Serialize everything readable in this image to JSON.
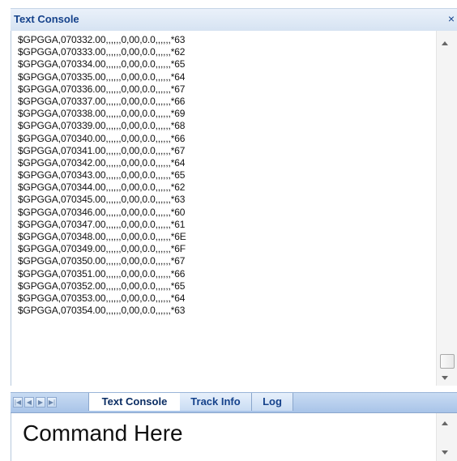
{
  "panel": {
    "title": "Text Console",
    "close_glyph": "×"
  },
  "console": {
    "lines": [
      "$GPGGA,070332.00,,,,,,0,00,0.0,,,,,,*63",
      "$GPGGA,070333.00,,,,,,0,00,0.0,,,,,,*62",
      "$GPGGA,070334.00,,,,,,0,00,0.0,,,,,,*65",
      "$GPGGA,070335.00,,,,,,0,00,0.0,,,,,,*64",
      "$GPGGA,070336.00,,,,,,0,00,0.0,,,,,,*67",
      "$GPGGA,070337.00,,,,,,0,00,0.0,,,,,,*66",
      "$GPGGA,070338.00,,,,,,0,00,0.0,,,,,,*69",
      "$GPGGA,070339.00,,,,,,0,00,0.0,,,,,,*68",
      "$GPGGA,070340.00,,,,,,0,00,0.0,,,,,,*66",
      "$GPGGA,070341.00,,,,,,0,00,0.0,,,,,,*67",
      "$GPGGA,070342.00,,,,,,0,00,0.0,,,,,,*64",
      "$GPGGA,070343.00,,,,,,0,00,0.0,,,,,,*65",
      "$GPGGA,070344.00,,,,,,0,00,0.0,,,,,,*62",
      "$GPGGA,070345.00,,,,,,0,00,0.0,,,,,,*63",
      "$GPGGA,070346.00,,,,,,0,00,0.0,,,,,,*60",
      "$GPGGA,070347.00,,,,,,0,00,0.0,,,,,,*61",
      "$GPGGA,070348.00,,,,,,0,00,0.0,,,,,,*6E",
      "$GPGGA,070349.00,,,,,,0,00,0.0,,,,,,*6F",
      "$GPGGA,070350.00,,,,,,0,00,0.0,,,,,,*67",
      "$GPGGA,070351.00,,,,,,0,00,0.0,,,,,,*66",
      "$GPGGA,070352.00,,,,,,0,00,0.0,,,,,,*65",
      "$GPGGA,070353.00,,,,,,0,00,0.0,,,,,,*64",
      "$GPGGA,070354.00,,,,,,0,00,0.0,,,,,,*63"
    ]
  },
  "tabs": [
    {
      "label": "Text Console",
      "active": true
    },
    {
      "label": "Track Info",
      "active": false
    },
    {
      "label": "Log",
      "active": false
    }
  ],
  "tab_nav": {
    "first_icon": "first-page-icon",
    "prev_icon": "prev-page-icon",
    "next_icon": "next-page-icon",
    "last_icon": "last-page-icon"
  },
  "command": {
    "value": "Command Here"
  },
  "colors": {
    "title_text": "#15428b",
    "tab_strip": "#a8c4e8"
  }
}
